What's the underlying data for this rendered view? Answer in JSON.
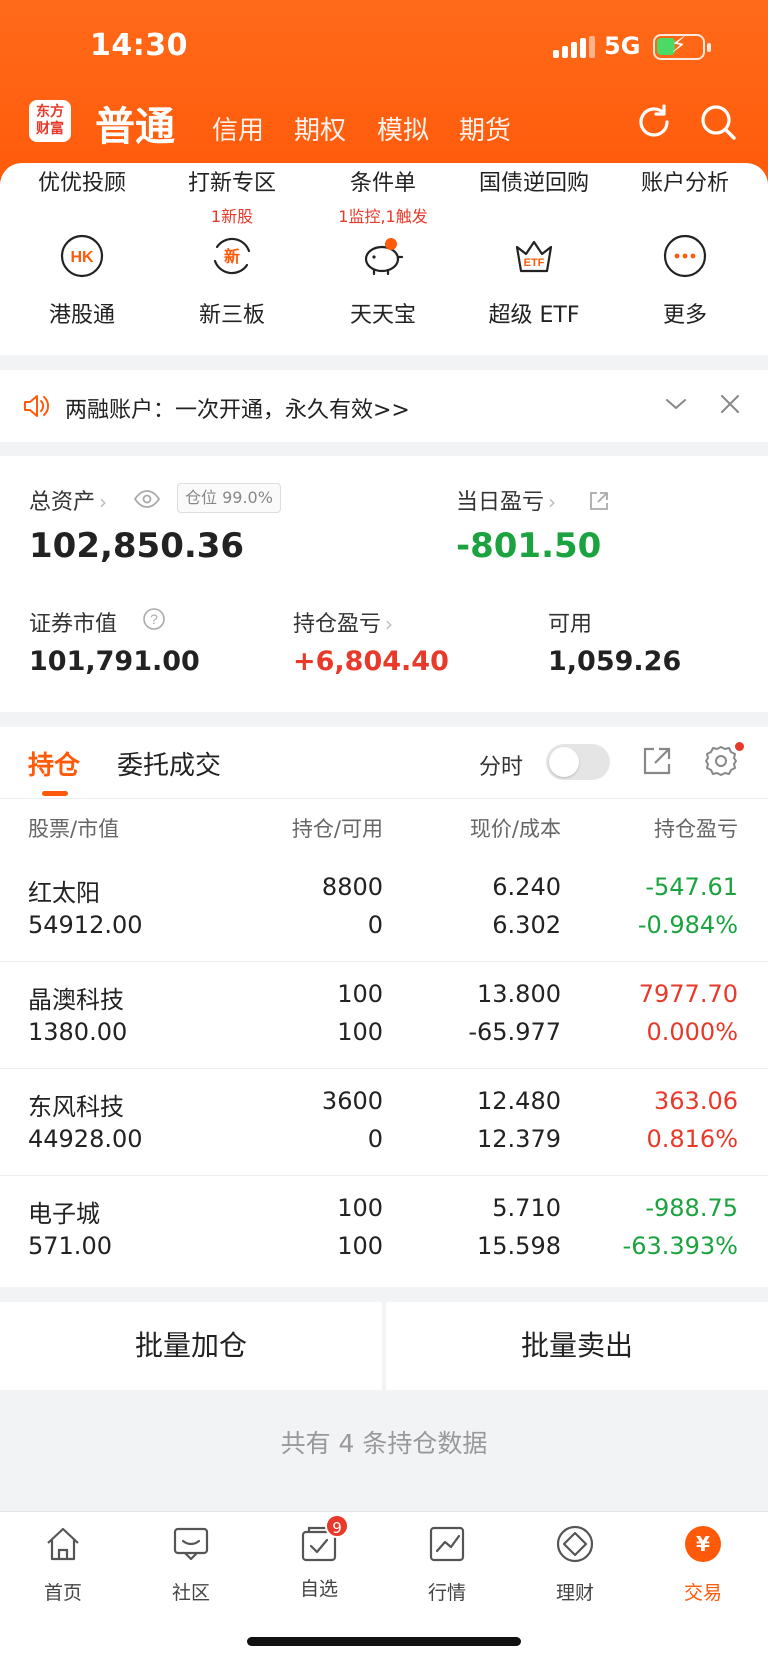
{
  "status_bar": {
    "time": "14:30",
    "network": "5G"
  },
  "header": {
    "logo_text": "东方\n财富",
    "active_tab": "普通",
    "tabs": [
      "信用",
      "期权",
      "模拟",
      "期货"
    ]
  },
  "quick_links": [
    {
      "label": "优优投顾",
      "sub": ""
    },
    {
      "label": "打新专区",
      "sub": "1新股"
    },
    {
      "label": "条件单",
      "sub": "1监控,1触发"
    },
    {
      "label": "国债逆回购",
      "sub": ""
    },
    {
      "label": "账户分析",
      "sub": ""
    }
  ],
  "services": [
    {
      "label": "港股通",
      "icon": "hk-icon"
    },
    {
      "label": "新三板",
      "icon": "xin-icon"
    },
    {
      "label": "天天宝",
      "icon": "piggy-bank-icon"
    },
    {
      "label": "超级 ETF",
      "icon": "etf-crown-icon"
    },
    {
      "label": "更多",
      "icon": "more-icon"
    }
  ],
  "notice": {
    "text": "两融账户：一次开通，永久有效>>"
  },
  "assets": {
    "total_label": "总资产",
    "position_tag": "仓位 99.0%",
    "total_value": "102,850.36",
    "daily_pl_label": "当日盈亏",
    "daily_pl_value": "-801.50",
    "market_value_label": "证券市值",
    "market_value": "101,791.00",
    "holding_pl_label": "持仓盈亏",
    "holding_pl_value": "+6,804.40",
    "available_label": "可用",
    "available_value": "1,059.26"
  },
  "holdings": {
    "tab_active": "持仓",
    "tab_other": "委托成交",
    "fenshi_label": "分时",
    "columns": [
      "股票/市值",
      "持仓/可用",
      "现价/成本",
      "持仓盈亏"
    ],
    "rows": [
      {
        "name": "红太阳",
        "market_value": "54912.00",
        "qty": "8800",
        "avail": "0",
        "price": "6.240",
        "cost": "6.302",
        "pl": "-547.61",
        "pl_pct": "-0.984%",
        "trend": "down"
      },
      {
        "name": "晶澳科技",
        "market_value": "1380.00",
        "qty": "100",
        "avail": "100",
        "price": "13.800",
        "cost": "-65.977",
        "pl": "7977.70",
        "pl_pct": "0.000%",
        "trend": "up"
      },
      {
        "name": "东风科技",
        "market_value": "44928.00",
        "qty": "3600",
        "avail": "0",
        "price": "12.480",
        "cost": "12.379",
        "pl": "363.06",
        "pl_pct": "0.816%",
        "trend": "up"
      },
      {
        "name": "电子城",
        "market_value": "571.00",
        "qty": "100",
        "avail": "100",
        "price": "5.710",
        "cost": "15.598",
        "pl": "-988.75",
        "pl_pct": "-63.393%",
        "trend": "down"
      }
    ]
  },
  "batch": {
    "add_label": "批量加仓",
    "sell_label": "批量卖出"
  },
  "count_text": "共有 4 条持仓数据",
  "tabbar": {
    "items": [
      {
        "label": "首页",
        "icon": "home-icon"
      },
      {
        "label": "社区",
        "icon": "community-icon"
      },
      {
        "label": "自选",
        "icon": "watchlist-icon",
        "badge": "9"
      },
      {
        "label": "行情",
        "icon": "market-icon"
      },
      {
        "label": "理财",
        "icon": "wealth-icon"
      },
      {
        "label": "交易",
        "icon": "trade-icon",
        "active": true
      }
    ]
  },
  "colors": {
    "brand": "#ff5a0a",
    "up": "#e8392a",
    "down": "#1aa33e"
  }
}
